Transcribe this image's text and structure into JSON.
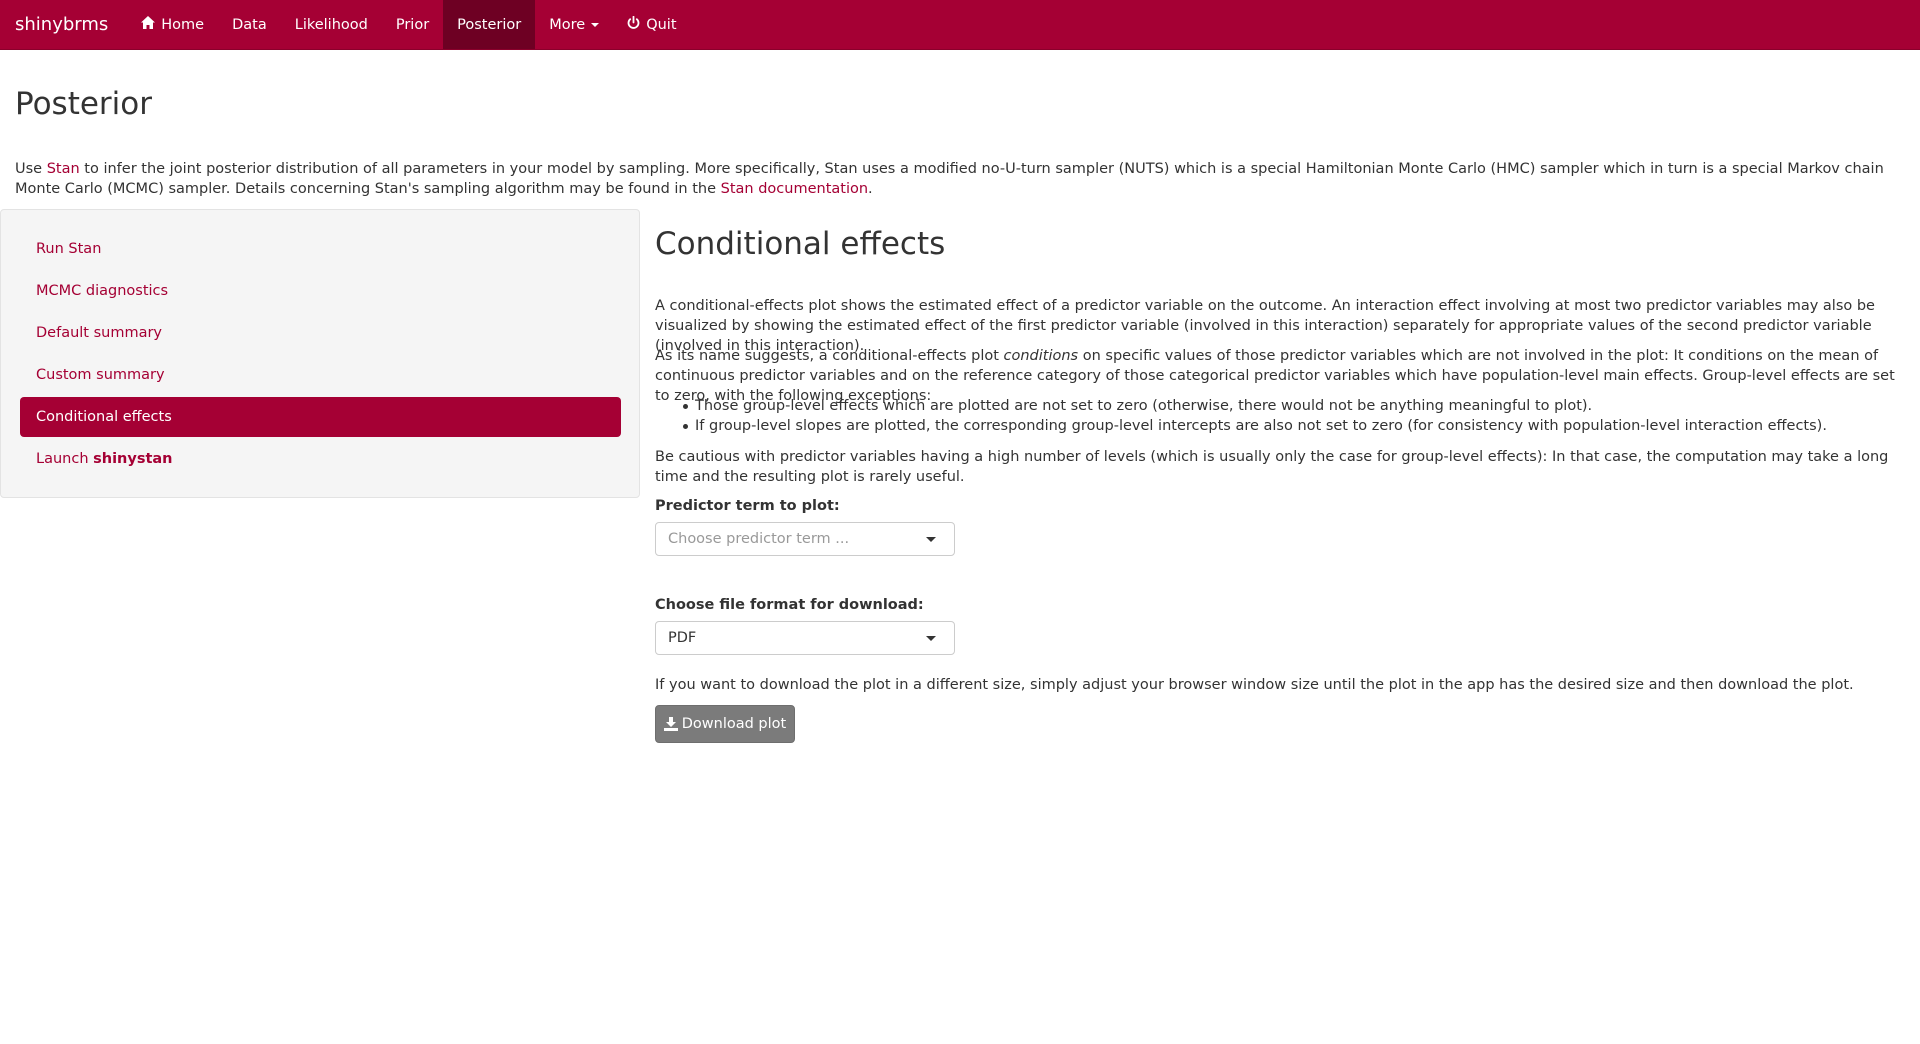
{
  "navbar": {
    "brand": "shinybrms",
    "items": [
      {
        "label": "Home",
        "icon": "home-icon"
      },
      {
        "label": "Data"
      },
      {
        "label": "Likelihood"
      },
      {
        "label": "Prior"
      },
      {
        "label": "Posterior"
      },
      {
        "label": "More",
        "icon": "caret-down-icon"
      },
      {
        "label": "Quit",
        "icon": "power-icon"
      }
    ],
    "active": "Posterior"
  },
  "colors": {
    "accent": "#a50034",
    "button": "#7b7b7b"
  },
  "page": {
    "title": "Posterior",
    "intro": {
      "part1": "Use ",
      "stan_link": "Stan",
      "part2": " to infer the joint posterior distribution of all parameters in your model by sampling. More specifically, Stan uses a modified no-U-turn sampler (NUTS) which is a special Hamiltonian Monte Carlo (HMC) sampler which in turn is a special Markov chain Monte Carlo (MCMC) sampler. Details concerning Stan's sampling algorithm may be found in the ",
      "doc_link": "Stan documentation",
      "part3": "."
    }
  },
  "sidebar": {
    "items": [
      {
        "label": "Run Stan"
      },
      {
        "label": "MCMC diagnostics"
      },
      {
        "label": "Default summary"
      },
      {
        "label": "Custom summary"
      },
      {
        "label": "Conditional effects"
      },
      {
        "label": "Launch ",
        "bold": "shinystan"
      }
    ],
    "active": "Conditional effects"
  },
  "main": {
    "heading": "Conditional effects",
    "p1": "A conditional-effects plot shows the estimated effect of a predictor variable on the outcome. An interaction effect involving at most two predictor variables may also be visualized by showing the estimated effect of the first predictor variable (involved in this interaction) separately for appropriate values of the second predictor variable (involved in this interaction).",
    "p2": {
      "part1": "As its name suggests, a conditional-effects plot ",
      "em": "conditions",
      "part2": " on specific values of those predictor variables which are not involved in the plot: It conditions on the mean of continuous predictor variables and on the reference category of those categorical predictor variables which have population-level main effects. Group-level effects are set to zero, with the following exceptions:"
    },
    "bullets": [
      "Those group-level effects which are plotted are not set to zero (otherwise, there would not be anything meaningful to plot).",
      "If group-level slopes are plotted, the corresponding group-level intercepts are also not set to zero (for consistency with population-level interaction effects)."
    ],
    "p3": "Be cautious with predictor variables having a high number of levels (which is usually only the case for group-level effects): In that case, the computation may take a long time and the resulting plot is rarely useful.",
    "predictor_label": "Predictor term to plot:",
    "predictor_placeholder": "Choose predictor term ...",
    "format_label": "Choose file format for download:",
    "format_value": "PDF",
    "download_note": "If you want to download the plot in a different size, simply adjust your browser window size until the plot in the app has the desired size and then download the plot.",
    "download_button": "Download plot"
  }
}
